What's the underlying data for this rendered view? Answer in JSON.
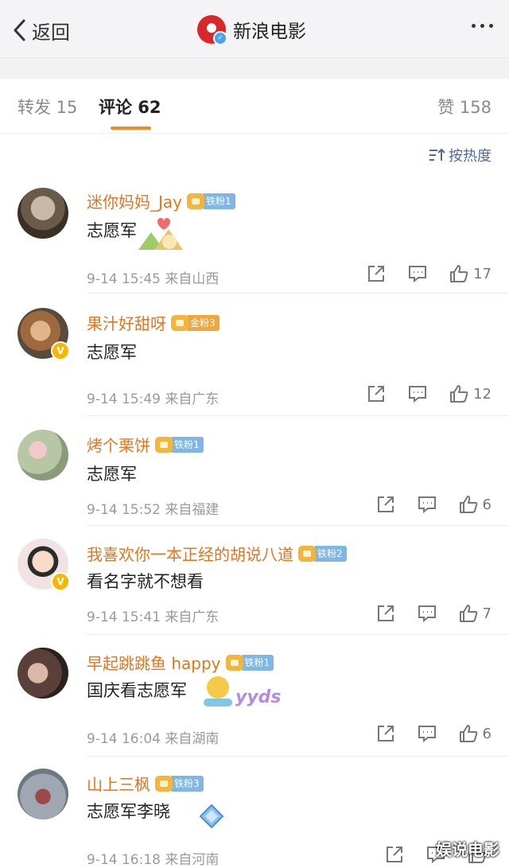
{
  "header": {
    "back_label": "返回",
    "title": "新浪电影"
  },
  "tabs": {
    "repost": "转发 15",
    "comments": "评论 62",
    "likes": "赞 158"
  },
  "sort_label": "按热度",
  "comments": [
    {
      "name": "迷你妈妈_Jay",
      "badge": "铁粉1",
      "badge_type": "iron",
      "text": "志愿军",
      "time": "9-14 15:45",
      "location": "来自山西",
      "likes": "17"
    },
    {
      "name": "果汁好甜呀",
      "badge": "金粉3",
      "badge_type": "gold",
      "text": "志愿军",
      "time": "9-14 15:49",
      "location": "来自广东",
      "likes": "12"
    },
    {
      "name": "烤个栗饼",
      "badge": "铁粉1",
      "badge_type": "iron",
      "text": "志愿军",
      "time": "9-14 15:52",
      "location": "来自福建",
      "likes": "6"
    },
    {
      "name": "我喜欢你一本正经的胡说八道",
      "badge": "铁粉2",
      "badge_type": "iron",
      "text": "看名字就不想看",
      "time": "9-14 15:41",
      "location": "来自广东",
      "likes": "7"
    },
    {
      "name": "早起跳跳鱼 happy",
      "badge": "铁粉1",
      "badge_type": "iron",
      "text": "国庆看志愿军",
      "time": "9-14 16:04",
      "location": "来自湖南",
      "likes": "6"
    },
    {
      "name": "山上三枫",
      "badge": "铁粉3",
      "badge_type": "iron",
      "text": "志愿军李晓",
      "time": "9-14 16:18",
      "location": "来自河南",
      "likes": ""
    }
  ],
  "emoji_text": "yyds",
  "watermark": "娱说电影",
  "colors": {
    "username": "#e0761f",
    "accent": "#f48a25",
    "sort": "#506b94"
  }
}
